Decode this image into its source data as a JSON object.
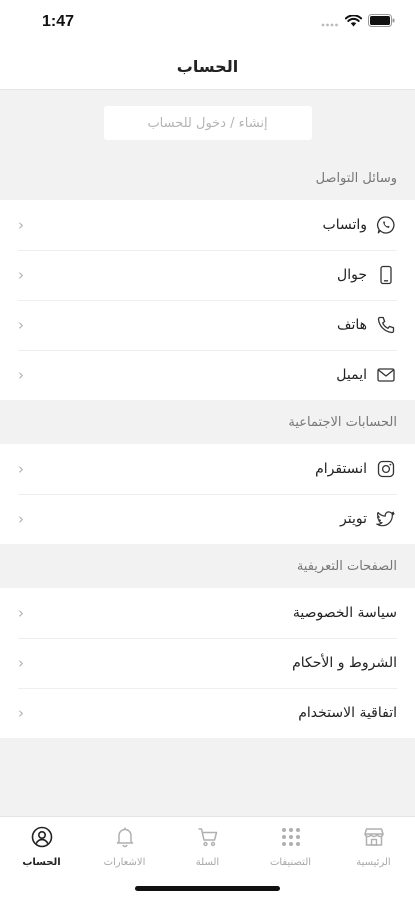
{
  "status_bar": {
    "time": "1:47"
  },
  "nav": {
    "title": "الحساب"
  },
  "login": {
    "label": "إنشاء / دخول للحساب"
  },
  "sections": [
    {
      "title": "وسائل التواصل",
      "items": [
        {
          "label": "واتساب",
          "icon": "whatsapp-icon"
        },
        {
          "label": "جوال",
          "icon": "mobile-icon"
        },
        {
          "label": "هاتف",
          "icon": "phone-icon"
        },
        {
          "label": "ايميل",
          "icon": "email-icon"
        }
      ]
    },
    {
      "title": "الحسابات الاجتماعية",
      "items": [
        {
          "label": "انستقرام",
          "icon": "instagram-icon"
        },
        {
          "label": "تويتر",
          "icon": "twitter-icon"
        }
      ]
    },
    {
      "title": "الصفحات التعريفية",
      "items": [
        {
          "label": "سياسة الخصوصية"
        },
        {
          "label": "الشروط و الأحكام"
        },
        {
          "label": "اتفاقية الاستخدام"
        }
      ]
    }
  ],
  "tab_bar": {
    "tabs": [
      {
        "label": "الحساب",
        "icon": "account-icon",
        "active": true
      },
      {
        "label": "الاشعارات",
        "icon": "bell-icon",
        "active": false
      },
      {
        "label": "السلة",
        "icon": "cart-icon",
        "active": false
      },
      {
        "label": "التصنيفات",
        "icon": "grid-icon",
        "active": false
      },
      {
        "label": "الرئيسية",
        "icon": "store-icon",
        "active": false
      }
    ]
  },
  "colors": {
    "background": "#f2f2f2",
    "surface": "#ffffff",
    "text": "#222222",
    "muted": "#a8a8a8"
  }
}
